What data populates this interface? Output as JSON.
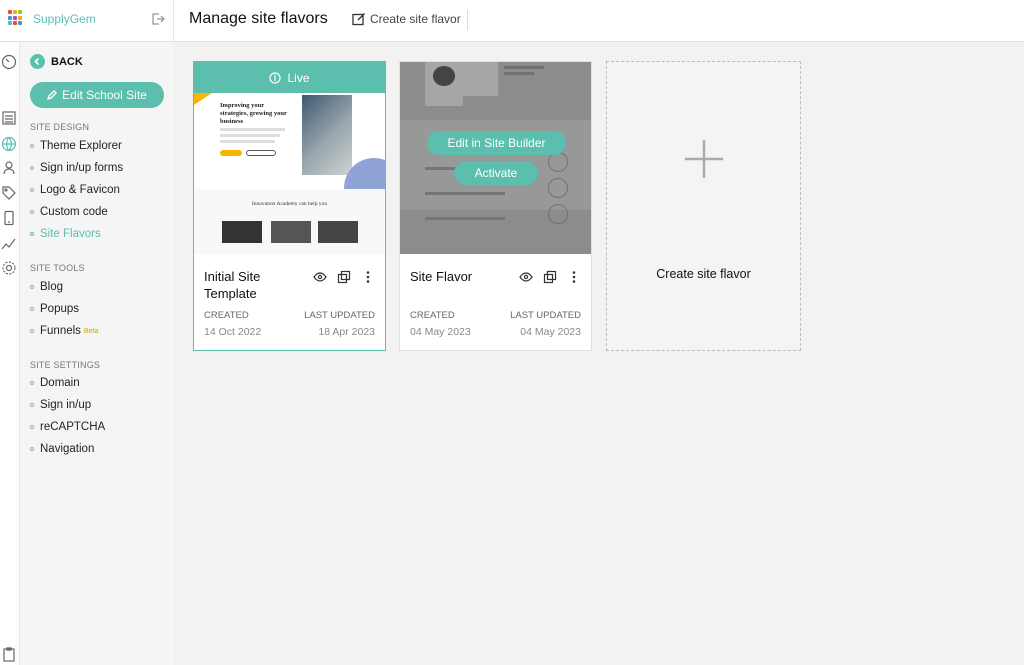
{
  "app": {
    "name": "SupplyGem"
  },
  "header": {
    "title": "Manage site flavors",
    "create_label": "Create site flavor"
  },
  "sidebar": {
    "back_label": "BACK",
    "edit_button": "Edit School Site",
    "sections": [
      {
        "title": "SITE DESIGN",
        "items": [
          "Theme Explorer",
          "Sign in/up forms",
          "Logo & Favicon",
          "Custom code",
          "Site Flavors"
        ]
      },
      {
        "title": "SITE TOOLS",
        "items": [
          "Blog",
          "Popups",
          "Funnels"
        ]
      },
      {
        "title": "SITE SETTINGS",
        "items": [
          "Domain",
          "Sign in/up",
          "reCAPTCHA",
          "Navigation"
        ]
      }
    ],
    "active_item": "Site Flavors",
    "beta_label": "Beta"
  },
  "cards": [
    {
      "name": "Initial Site Template",
      "status": "Live",
      "created_label": "CREATED",
      "created": "14 Oct 2022",
      "updated_label": "LAST UPDATED",
      "updated": "18 Apr 2023",
      "preview": {
        "headline": "Improving your strategies, growing your business",
        "subheading": "Innovators Academy can help you"
      }
    },
    {
      "name": "Site Flavor",
      "created_label": "CREATED",
      "created": "04 May 2023",
      "updated_label": "LAST UPDATED",
      "updated": "04 May 2023",
      "hover_actions": [
        "Edit in Site Builder",
        "Activate"
      ]
    }
  ],
  "new_card": {
    "label": "Create site flavor"
  },
  "colors": {
    "accent": "#5cbfae",
    "beta": "#d9a300"
  }
}
